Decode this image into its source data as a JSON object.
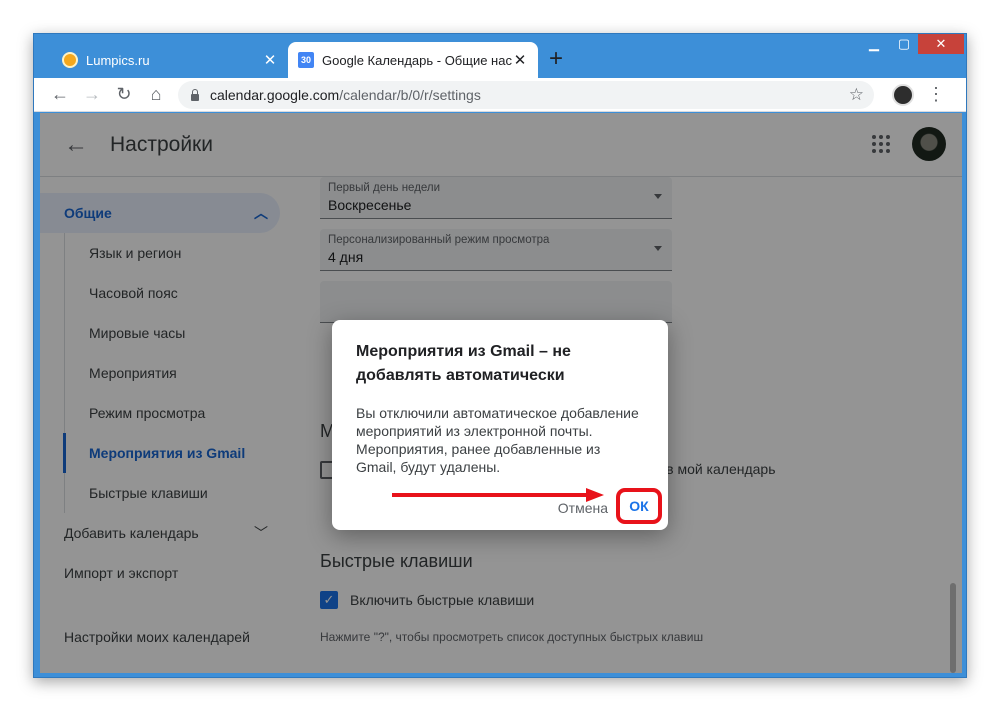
{
  "browser": {
    "tabs": [
      {
        "title": "Lumpics.ru",
        "icon": "lumpics-orange-icon"
      },
      {
        "title": "Google Календарь - Общие нас",
        "icon": "calendar-icon",
        "icon_text": "30"
      }
    ],
    "url_host": "calendar.google.com",
    "url_path": "/calendar/b/0/r/settings"
  },
  "header": {
    "title": "Настройки"
  },
  "sidebar": {
    "general_label": "Общие",
    "items": [
      {
        "label": "Язык и регион"
      },
      {
        "label": "Часовой пояс"
      },
      {
        "label": "Мировые часы"
      },
      {
        "label": "Мероприятия"
      },
      {
        "label": "Режим просмотра"
      },
      {
        "label": "Мероприятия из Gmail"
      },
      {
        "label": "Быстрые клавиши"
      }
    ],
    "add_calendar_label": "Добавить календарь",
    "import_export_label": "Импорт и экспорт",
    "my_calendars_label": "Настройки моих календарей"
  },
  "content": {
    "fields": [
      {
        "label": "Первый день недели",
        "value": "Воскресенье"
      },
      {
        "label": "Персонализированный режим просмотра",
        "value": "4 дня"
      }
    ],
    "section_letter": "М",
    "gmail_checkbox_tail": "il в мой календарь",
    "shortcuts_title": "Быстрые клавиши",
    "shortcuts_checkbox": "Включить быстрые клавиши",
    "shortcuts_hint": "Нажмите \"?\", чтобы просмотреть список доступных быстрых клавиш"
  },
  "dialog": {
    "title": "Мероприятия из Gmail – не добавлять автоматически",
    "body": "Вы отключили автоматическое добавление мероприятий из электронной почты. Мероприятия, ранее добавленные из Gmail, будут удалены.",
    "cancel_label": "Отмена",
    "ok_label": "ОК"
  },
  "colors": {
    "accent": "#1a73e8",
    "highlight": "#e8121a",
    "frame": "#3d8fd8"
  }
}
